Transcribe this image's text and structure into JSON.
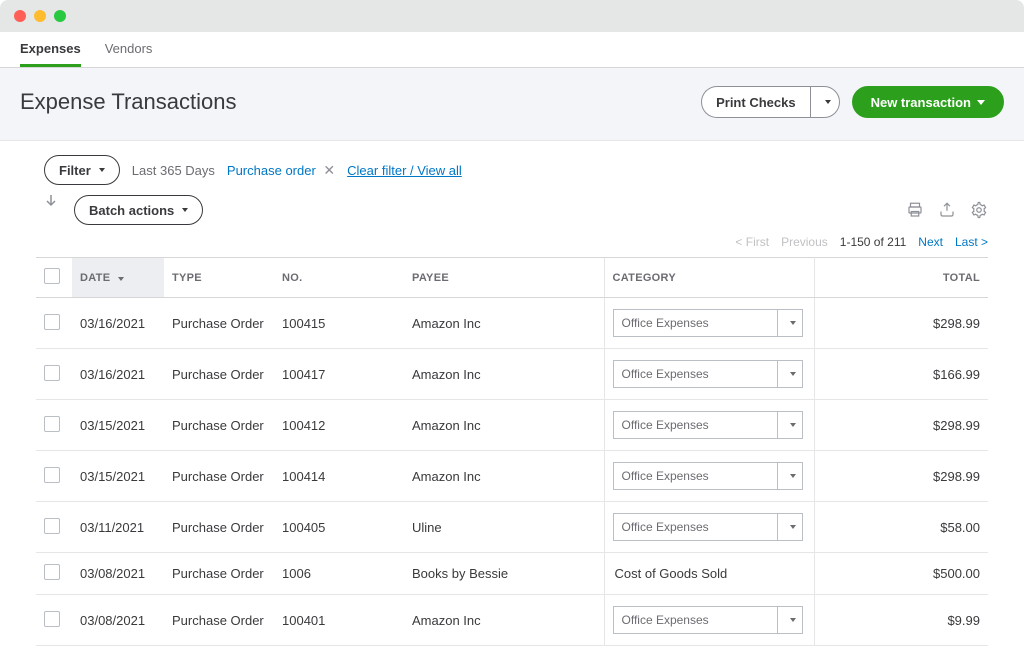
{
  "tabs": {
    "expenses": "Expenses",
    "vendors": "Vendors"
  },
  "header": {
    "title": "Expense Transactions",
    "print_checks": "Print Checks",
    "new_transaction": "New transaction"
  },
  "toolbar": {
    "filter": "Filter",
    "batch_actions": "Batch actions",
    "range": "Last 365 Days",
    "chip": "Purchase order",
    "clear": "Clear filter / View all"
  },
  "paging": {
    "first": "< First",
    "previous": "Previous",
    "range": "1-150 of 211",
    "next": "Next",
    "last": "Last >"
  },
  "columns": {
    "date": "DATE",
    "type": "TYPE",
    "no": "NO.",
    "payee": "PAYEE",
    "category": "CATEGORY",
    "total": "TOTAL"
  },
  "rows": [
    {
      "date": "03/16/2021",
      "type": "Purchase Order",
      "no": "100415",
      "payee": "Amazon Inc",
      "category": "Office Expenses",
      "category_editable": true,
      "total": "$298.99"
    },
    {
      "date": "03/16/2021",
      "type": "Purchase Order",
      "no": "100417",
      "payee": "Amazon Inc",
      "category": "Office Expenses",
      "category_editable": true,
      "total": "$166.99"
    },
    {
      "date": "03/15/2021",
      "type": "Purchase Order",
      "no": "100412",
      "payee": "Amazon Inc",
      "category": "Office Expenses",
      "category_editable": true,
      "total": "$298.99"
    },
    {
      "date": "03/15/2021",
      "type": "Purchase Order",
      "no": "100414",
      "payee": "Amazon Inc",
      "category": "Office Expenses",
      "category_editable": true,
      "total": "$298.99"
    },
    {
      "date": "03/11/2021",
      "type": "Purchase Order",
      "no": "100405",
      "payee": "Uline",
      "category": "Office Expenses",
      "category_editable": true,
      "total": "$58.00"
    },
    {
      "date": "03/08/2021",
      "type": "Purchase Order",
      "no": "1006",
      "payee": "Books by Bessie",
      "category": "Cost of Goods Sold",
      "category_editable": false,
      "total": "$500.00"
    },
    {
      "date": "03/08/2021",
      "type": "Purchase Order",
      "no": "100401",
      "payee": "Amazon Inc",
      "category": "Office Expenses",
      "category_editable": true,
      "total": "$9.99"
    }
  ]
}
